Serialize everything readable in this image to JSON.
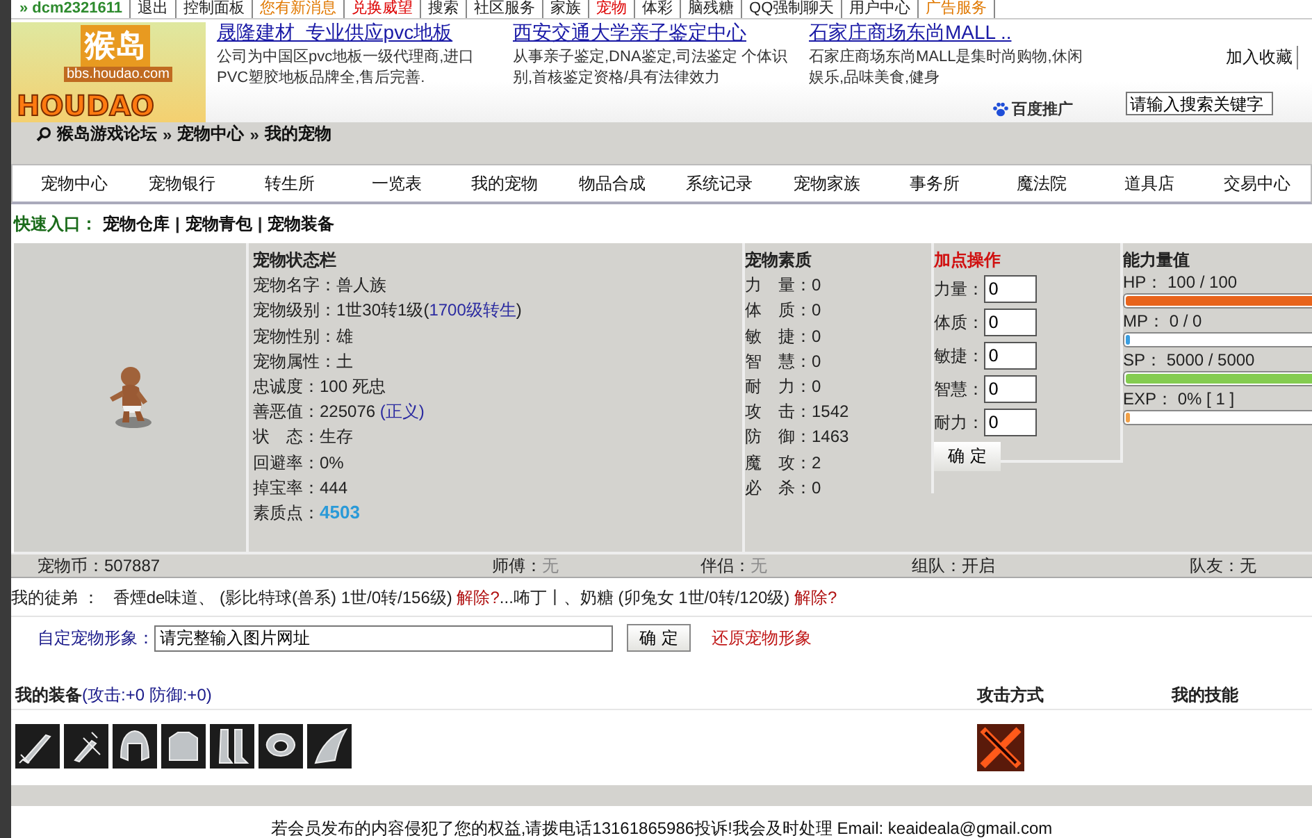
{
  "top_nav": [
    {
      "label": "» dcm2321611",
      "kind": "user"
    },
    {
      "label": "退出",
      "kind": "plain"
    },
    {
      "label": "控制面板",
      "kind": "menu"
    },
    {
      "label": "您有新消息",
      "kind": "notice"
    },
    {
      "label": "兑换威望",
      "kind": "alert"
    },
    {
      "label": "搜索",
      "kind": "plain"
    },
    {
      "label": "社区服务",
      "kind": "menu"
    },
    {
      "label": "家族",
      "kind": "plain"
    },
    {
      "label": "宠物",
      "kind": "alert"
    },
    {
      "label": "体彩",
      "kind": "plain"
    },
    {
      "label": "脑残糖",
      "kind": "plain"
    },
    {
      "label": "QQ强制聊天",
      "kind": "plain"
    },
    {
      "label": "用户中心",
      "kind": "plain"
    },
    {
      "label": "广告服务",
      "kind": "notice"
    }
  ],
  "logo": {
    "mark": "猴岛",
    "url": "bbs.houdao.com",
    "wordmark": "HOUDAO"
  },
  "ads": [
    {
      "title": "晟隆建材  专业供应pvc地板",
      "text": "公司为中国区pvc地板一级代理商,进口  PVC塑胶地板品牌全,售后完善."
    },
    {
      "title": "西安交通大学亲子鉴定中心",
      "text": "从事亲子鉴定,DNA鉴定,司法鉴定 个体识别,首核鉴定资格/具有法律效力"
    },
    {
      "title": "石家庄商场东尚MALL ..",
      "text": "石家庄商场东尚MALL是集时尚购物,休闲娱乐,品味美食,健身"
    }
  ],
  "bookmark": "加入收藏",
  "baidu": "百度推广",
  "search": {
    "placeholder": "请输入搜索关键字"
  },
  "breadcrumb": {
    "separator": "»",
    "items": [
      "猴岛游戏论坛",
      "宠物中心",
      "我的宠物"
    ]
  },
  "tabs": [
    "宠物中心",
    "宠物银行",
    "转生所",
    "一览表",
    "我的宠物",
    "物品合成",
    "系统记录",
    "宠物家族",
    "事务所",
    "魔法院",
    "道具店",
    "交易中心"
  ],
  "quick_links": {
    "label": "快速入口：",
    "separator": "|",
    "items": [
      "宠物仓库",
      "宠物青包",
      "宠物装备"
    ]
  },
  "status": {
    "title": "宠物状态栏",
    "rows": [
      {
        "label": "宠物名字：",
        "parts": [
          {
            "text": "兽人族",
            "kind": "plain"
          }
        ]
      },
      {
        "label": "宠物级别：",
        "parts": [
          {
            "text": "1世30转1级(",
            "kind": "plain"
          },
          {
            "text": "1700级转生",
            "kind": "link"
          },
          {
            "text": ")",
            "kind": "plain"
          }
        ]
      },
      {
        "label": "宠物性别：",
        "parts": [
          {
            "text": "雄",
            "kind": "plain"
          }
        ]
      },
      {
        "label": "宠物属性：",
        "parts": [
          {
            "text": "土",
            "kind": "plain"
          }
        ]
      },
      {
        "label": "忠诚度：",
        "parts": [
          {
            "text": "100 死忠",
            "kind": "plain"
          }
        ]
      },
      {
        "label": "善恶值：",
        "parts": [
          {
            "text": "225076 ",
            "kind": "plain"
          },
          {
            "text": "(正义)",
            "kind": "link"
          }
        ]
      },
      {
        "label": "状　态：",
        "parts": [
          {
            "text": "生存",
            "kind": "plain"
          }
        ]
      },
      {
        "label": "回避率：",
        "parts": [
          {
            "text": "0%",
            "kind": "plain"
          }
        ]
      },
      {
        "label": "掉宝率：",
        "parts": [
          {
            "text": "444",
            "kind": "plain"
          }
        ]
      },
      {
        "label": "素质点：",
        "parts": [
          {
            "text": "4503",
            "kind": "points"
          }
        ]
      }
    ]
  },
  "quality": {
    "title": "宠物素质",
    "rows": [
      {
        "label": "力　量：",
        "value": "0"
      },
      {
        "label": "体　质：",
        "value": "0"
      },
      {
        "label": "敏　捷：",
        "value": "0"
      },
      {
        "label": "智　慧：",
        "value": "0"
      },
      {
        "label": "耐　力：",
        "value": "0"
      },
      {
        "label": "攻　击：",
        "value": "1542"
      },
      {
        "label": "防　御：",
        "value": "1463"
      },
      {
        "label": "魔　攻：",
        "value": "2"
      },
      {
        "label": "必　杀：",
        "value": "0"
      }
    ]
  },
  "add_points": {
    "title": "加点操作",
    "fields": [
      {
        "label": "力量：",
        "value": "0"
      },
      {
        "label": "体质：",
        "value": "0"
      },
      {
        "label": "敏捷：",
        "value": "0"
      },
      {
        "label": "智慧：",
        "value": "0"
      },
      {
        "label": "耐力：",
        "value": "0"
      }
    ],
    "button": "确 定"
  },
  "ability": {
    "title": "能力量值",
    "meters": [
      {
        "label": "HP： 100 / 100",
        "level": 1,
        "color": "#e8641c"
      },
      {
        "label": "MP： 0 / 0",
        "level": 0.01,
        "color": "#3a9ee0"
      },
      {
        "label": "SP： 5000 / 5000",
        "level": 1,
        "color": "#84cc50"
      },
      {
        "label": "EXP： 0% [ 1 ]",
        "level": 0.01,
        "color": "#f0a048"
      }
    ]
  },
  "summary": [
    {
      "label": "宠物币：",
      "value": "507887",
      "disabled": false
    },
    {
      "label": "师傅：",
      "value": "无",
      "disabled": true
    },
    {
      "label": "伴侣：",
      "value": "无",
      "disabled": true
    },
    {
      "label": "组队：",
      "value": "开启",
      "disabled": false
    },
    {
      "label": "队友：",
      "value": "无",
      "disabled": false
    }
  ],
  "apprentices": {
    "label": "我的徒弟 ：",
    "items": [
      {
        "text": "香煙de味道、 (影比特球(兽系) 1世/0转/156级)",
        "action": "解除?"
      },
      {
        "text": "...咘丁丨、奶糖 (卯兔女 1世/0转/120级)",
        "action": "解除?"
      }
    ]
  },
  "custom_image": {
    "label": "自定宠物形象：",
    "value": "请完整输入图片网址",
    "button": "确 定",
    "reset": "还原宠物形象"
  },
  "equipment": {
    "title": "我的装备",
    "bonus": "(攻击:+0 防御:+0)",
    "attack_title": "攻击方式",
    "skills_title": "我的技能",
    "items": [
      {
        "kind": "sword"
      },
      {
        "kind": "dagger"
      },
      {
        "kind": "helmet"
      },
      {
        "kind": "armor"
      },
      {
        "kind": "boots"
      },
      {
        "kind": "ring"
      },
      {
        "kind": "claw"
      }
    ]
  },
  "footer": "若会员发布的内容侵犯了您的权益,请拨电话13161865986投诉!我会及时处理 Email: keaideala@gmail.com"
}
